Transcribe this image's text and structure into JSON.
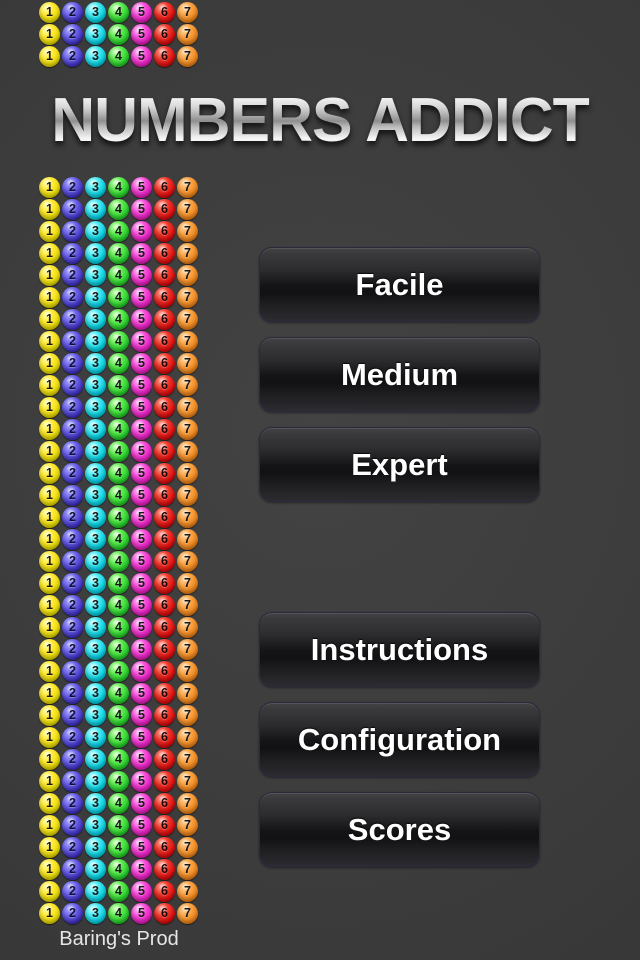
{
  "app": {
    "title": "NUMBERS ADDICT",
    "background_color": "#3c3c3c",
    "footer_credit": "Baring's Prod"
  },
  "balls": {
    "values": [
      "1",
      "2",
      "3",
      "4",
      "5",
      "6",
      "7"
    ],
    "colors": {
      "1": "#ffe834",
      "2": "#6a60e8",
      "3": "#3ce6f0",
      "4": "#56e84a",
      "5": "#f748da",
      "6": "#f03428",
      "7": "#f9a040"
    },
    "top_grid_rows": 3,
    "side_grid_rows": 34,
    "columns": 7
  },
  "menu": {
    "difficulty_buttons": [
      {
        "id": "facile",
        "label": "Facile"
      },
      {
        "id": "medium",
        "label": "Medium"
      },
      {
        "id": "expert",
        "label": "Expert"
      }
    ],
    "option_buttons": [
      {
        "id": "instructions",
        "label": "Instructions"
      },
      {
        "id": "configuration",
        "label": "Configuration"
      },
      {
        "id": "scores",
        "label": "Scores"
      }
    ]
  }
}
